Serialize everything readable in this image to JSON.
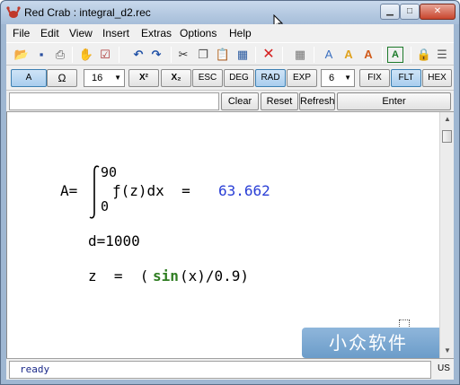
{
  "window": {
    "title": "Red Crab : integral_d2.rec"
  },
  "window_buttons": {
    "minimize": "▁",
    "maximize": "□",
    "close": "✕"
  },
  "menu": [
    "File",
    "Edit",
    "View",
    "Insert",
    "Extras",
    "Options",
    "Help"
  ],
  "toolbar_icons": [
    "open-icon",
    "save-icon",
    "print-icon",
    "hand-icon",
    "checklist-icon",
    "undo-icon",
    "redo-icon",
    "cut-icon",
    "copy-icon",
    "paste-icon",
    "table-icon",
    "delete-icon",
    "grid-icon",
    "font-color-icon",
    "font-style-icon",
    "font-size-icon",
    "text-box-icon",
    "lock-icon",
    "list-icon"
  ],
  "mode_toolbar": {
    "a_label": "A",
    "omega_label": "Ω",
    "font_size": "16",
    "sup_label": "X²",
    "sub_label": "X₂",
    "esc_label": "ESC",
    "deg_label": "DEG",
    "rad_label": "RAD",
    "exp_label": "EXP",
    "precision": "6",
    "fix_label": "FIX",
    "flt_label": "FLT",
    "hex_label": "HEX"
  },
  "actions": {
    "clear": "Clear",
    "reset": "Reset",
    "refresh": "Refresh",
    "enter": "Enter"
  },
  "worksheet": {
    "integral_lhs": "A=",
    "upper_limit": "90",
    "lower_limit": "0",
    "integrand": "ƒ(z)dx  =",
    "result": "63.662",
    "line2": "d=1000",
    "line3_prefix": "z  =  (",
    "line3_fn": "sin",
    "line3_suffix": "(x)/0.9)"
  },
  "watermark": {
    "text": "小众软件",
    "arrow": "›"
  },
  "status": {
    "text": "ready",
    "lang": "US"
  }
}
